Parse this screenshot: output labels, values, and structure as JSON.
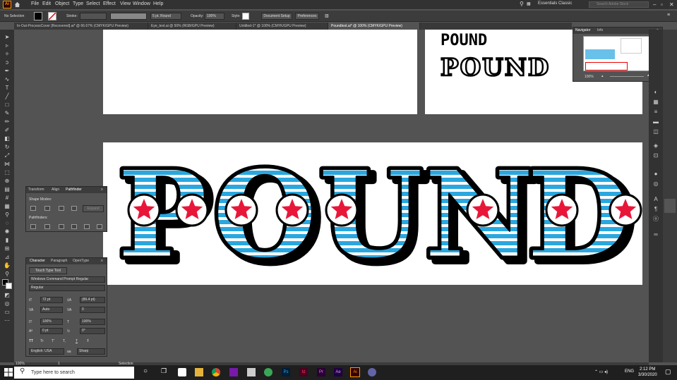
{
  "menubar": {
    "logo": "Ai",
    "items": [
      "File",
      "Edit",
      "Object",
      "Type",
      "Select",
      "Effect",
      "View",
      "Window",
      "Help"
    ],
    "workspace": "Essentials Classic",
    "search_placeholder": "Search Adobe Stock"
  },
  "control": {
    "selection": "No Selection",
    "stroke_label": "Stroke:",
    "brush": "5 pt. Round",
    "opacity_label": "Opacity:",
    "opacity_value": "100%",
    "style_label": "Style:",
    "document_setup": "Document Setup",
    "preferences": "Preferences"
  },
  "tabs": [
    {
      "label": "In-Out-ProcessCover [Recovered].ai* @ 66.67% (CMYK/GPU Preview)",
      "active": false
    },
    {
      "label": "Eye_text.ai @ 50% (RGB/GPU Preview)",
      "active": false
    },
    {
      "label": "Untitled-1* @ 100% (CMYK/GPU Preview)",
      "active": false
    },
    {
      "label": "Poundtext.ai* @ 100% (CMYK/GPU Preview)",
      "active": true
    }
  ],
  "artwork": {
    "word": "POUND",
    "small_word": "POUND",
    "outline_word": "POUND",
    "letters": [
      "P",
      "O",
      "U",
      "N",
      "D"
    ],
    "colors": {
      "stripe": "#2aa7df",
      "star": "#e8173a",
      "outline": "#000000"
    }
  },
  "navigator": {
    "tabs": [
      "Navigator",
      "Info"
    ],
    "zoom": "100%"
  },
  "pathfinder": {
    "tabs": [
      "Transform",
      "Align",
      "Pathfinder"
    ],
    "shape_modes": "Shape Modes:",
    "expand": "Expand",
    "pathfinders": "Pathfinders:"
  },
  "character": {
    "tabs": [
      "Character",
      "Paragraph",
      "OpenType"
    ],
    "touch_type": "Touch Type Tool",
    "font_family": "Windows Command Prompt Regular",
    "font_style": "Regular",
    "size": "72 pt",
    "leading": "(86.4 pt)",
    "kerning": "Auto",
    "tracking": "0",
    "vscale": "100%",
    "hscale": "100%",
    "baseline": "0 pt",
    "rotation": "0°",
    "caps": [
      "TT",
      "Tr",
      "T'",
      "T,",
      "T",
      "Ŧ"
    ],
    "language": "English: USA",
    "aa": "Sharp"
  },
  "status": {
    "zoom": "100%",
    "page": "1",
    "tool": "Selection"
  },
  "taskbar": {
    "search_placeholder": "Type here to search",
    "time": "2:12 PM",
    "date": "3/30/2020",
    "lang": "ENG",
    "apps": [
      "Ps",
      "Id",
      "Pr",
      "Ae",
      "Ai"
    ]
  }
}
